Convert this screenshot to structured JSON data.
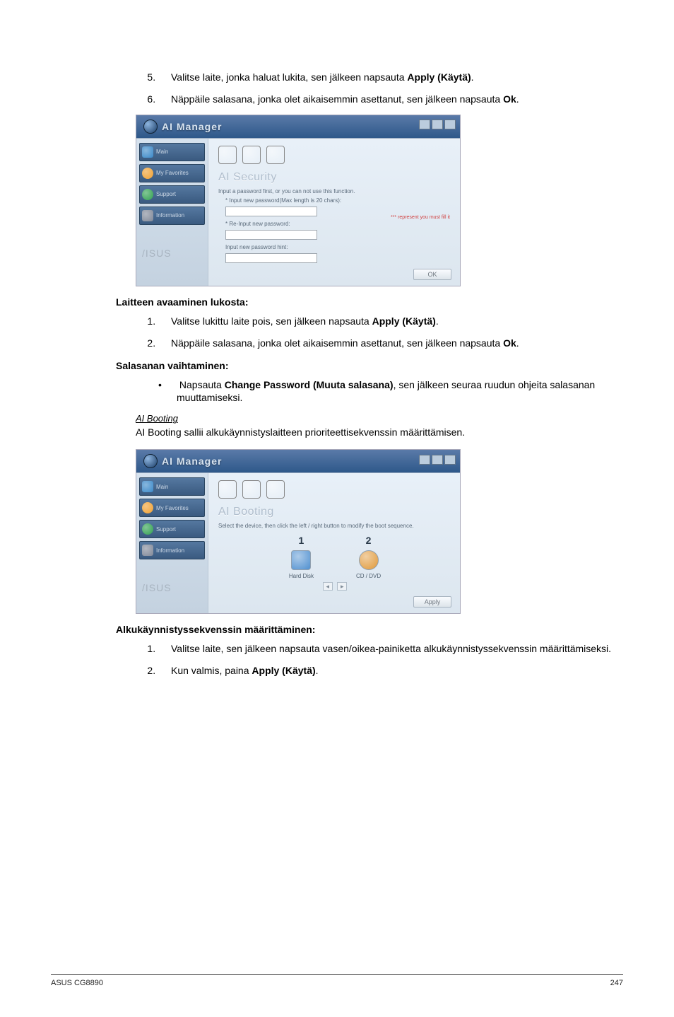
{
  "steps_top": [
    {
      "prefix": "Valitse laite, jonka haluat lukita, sen jälkeen napsauta ",
      "bold": "Apply (Käytä)",
      "suffix": "."
    },
    {
      "prefix": "Näppäile salasana, jonka olet aikaisemmin asettanut, sen jälkeen napsauta ",
      "bold": "Ok",
      "suffix": "."
    }
  ],
  "screenshot1": {
    "window_title": "AI Manager",
    "sidebar": [
      "Main",
      "My Favorites",
      "Support",
      "Information"
    ],
    "brand": "/ISUS",
    "section": "AI Security",
    "line1": "Input a password first, or you can not use this function.",
    "line2": "Input new password(Max length is 20 chars):",
    "line3": "Re-Input new password:",
    "hint": "*** represent you must fill it",
    "line4": "Input new password hint:",
    "ok": "OK"
  },
  "unlock_heading": "Laitteen avaaminen lukosta:",
  "unlock_steps": [
    {
      "prefix": "Valitse lukittu laite pois, sen jälkeen napsauta ",
      "bold": "Apply (Käytä)",
      "suffix": "."
    },
    {
      "prefix": "Näppäile salasana, jonka olet aikaisemmin asettanut, sen jälkeen napsauta ",
      "bold": "Ok",
      "suffix": "."
    }
  ],
  "pwd_heading": "Salasanan vaihtaminen:",
  "pwd_bullet": {
    "prefix": "Napsauta ",
    "bold": "Change Password (Muuta salasana)",
    "suffix": ", sen jälkeen seuraa ruudun ohjeita salasanan muuttamiseksi."
  },
  "aibooting_sub": "AI Booting",
  "aibooting_desc": "AI Booting sallii alkukäynnistyslaitteen prioriteettisekvenssin määrittämisen.",
  "screenshot2": {
    "window_title": "AI Manager",
    "sidebar": [
      "Main",
      "My Favorites",
      "Support",
      "Information"
    ],
    "brand": "/ISUS",
    "section": "AI Booting",
    "line1": "Select the device, then click the left / right button to modify the boot sequence.",
    "devices": [
      {
        "num": "1",
        "label": "Hard Disk"
      },
      {
        "num": "2",
        "label": "CD / DVD"
      }
    ],
    "apply": "Apply"
  },
  "bootseq_heading": "Alkukäynnistyssekvenssin määrittäminen:",
  "bootseq_steps": [
    {
      "text": "Valitse laite, sen jälkeen napsauta vasen/oikea-painiketta alkukäynnistyssekvenssin määrittämiseksi."
    },
    {
      "prefix": "Kun valmis, paina ",
      "bold": "Apply (Käytä)",
      "suffix": "."
    }
  ],
  "footer": {
    "left": "ASUS CG8890",
    "right": "247"
  }
}
